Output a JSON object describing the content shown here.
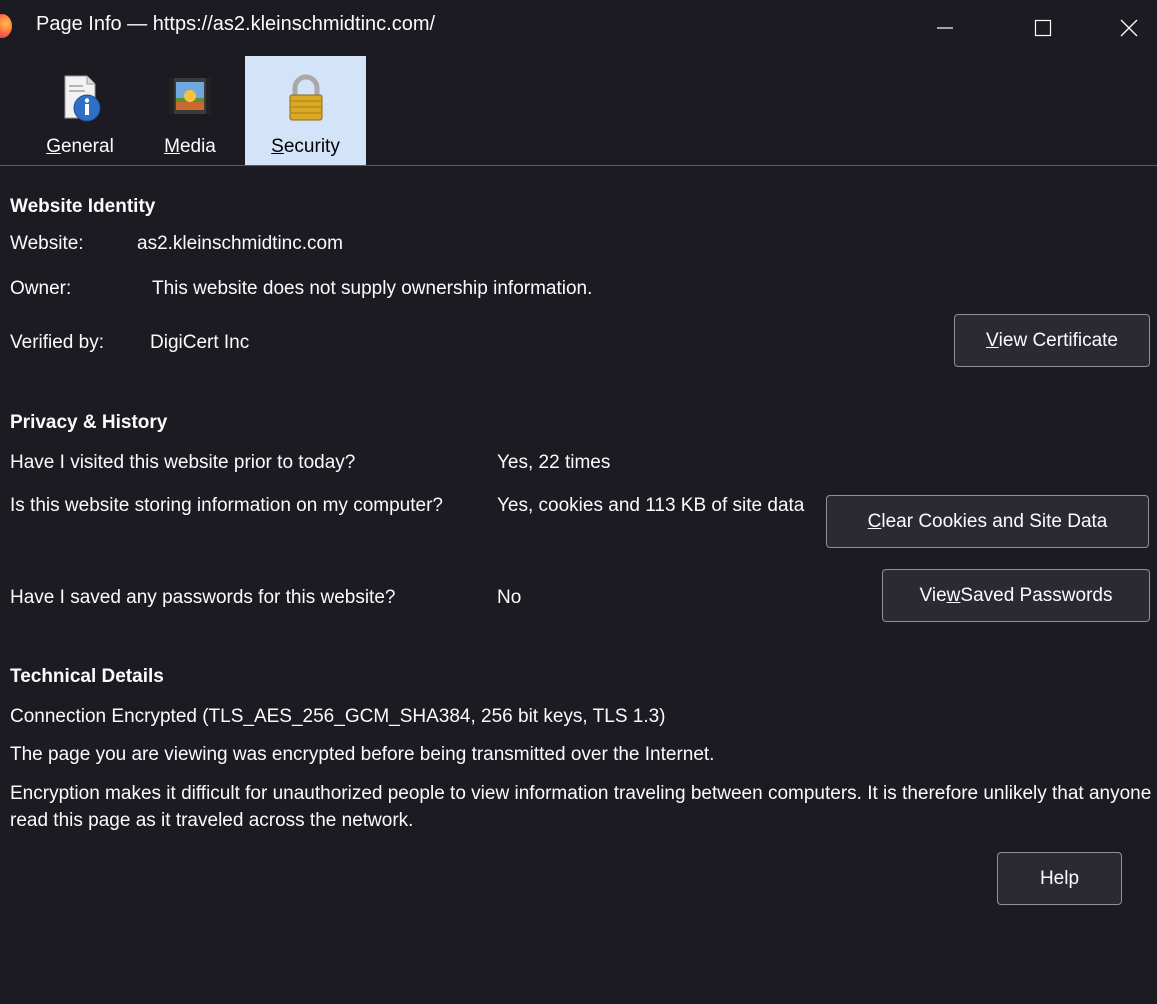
{
  "window": {
    "title": "Page Info — https://as2.kleinschmidtinc.com/",
    "minimize_glyph": "—",
    "maximize_glyph": "☐",
    "close_glyph": "✕"
  },
  "tabs": [
    {
      "label_prefix": "",
      "label_key": "G",
      "label_rest": "eneral",
      "icon": "document-info-icon"
    },
    {
      "label_prefix": "",
      "label_key": "M",
      "label_rest": "edia",
      "icon": "media-image-icon"
    },
    {
      "label_prefix": "",
      "label_key": "S",
      "label_rest": "ecurity",
      "icon": "padlock-icon"
    }
  ],
  "identity": {
    "heading": "Website Identity",
    "website_label": "Website:",
    "website_value": "as2.kleinschmidtinc.com",
    "owner_label": "Owner:",
    "owner_value": "This website does not supply ownership information.",
    "verified_label": "Verified by:",
    "verified_value": "DigiCert Inc",
    "view_cert_key": "V",
    "view_cert_rest": "iew Certificate"
  },
  "privacy": {
    "heading": "Privacy & History",
    "visited_q": "Have I visited this website prior to today?",
    "visited_a": "Yes, 22 times",
    "storing_q": "Is this website storing information on my computer?",
    "storing_a": "Yes, cookies and 113 KB of site data",
    "clear_key": "C",
    "clear_rest": "lear Cookies and Site Data",
    "passwords_q": "Have I saved any passwords for this website?",
    "passwords_a": "No",
    "view_pw_pre": "Vie",
    "view_pw_key": "w",
    "view_pw_rest": " Saved Passwords"
  },
  "technical": {
    "heading": "Technical Details",
    "line1": "Connection Encrypted (TLS_AES_256_GCM_SHA384, 256 bit keys, TLS 1.3)",
    "line2": "The page you are viewing was encrypted before being transmitted over the Internet.",
    "line3": "Encryption makes it difficult for unauthorized people to view information traveling between computers. It is therefore unlikely that anyone read this page as it traveled across the network."
  },
  "help_label": "Help",
  "colors": {
    "background": "#1c1b22",
    "text": "#fbfbfe",
    "selected_tab": "#d4e4f8",
    "button_border": "#8f8f9d"
  }
}
